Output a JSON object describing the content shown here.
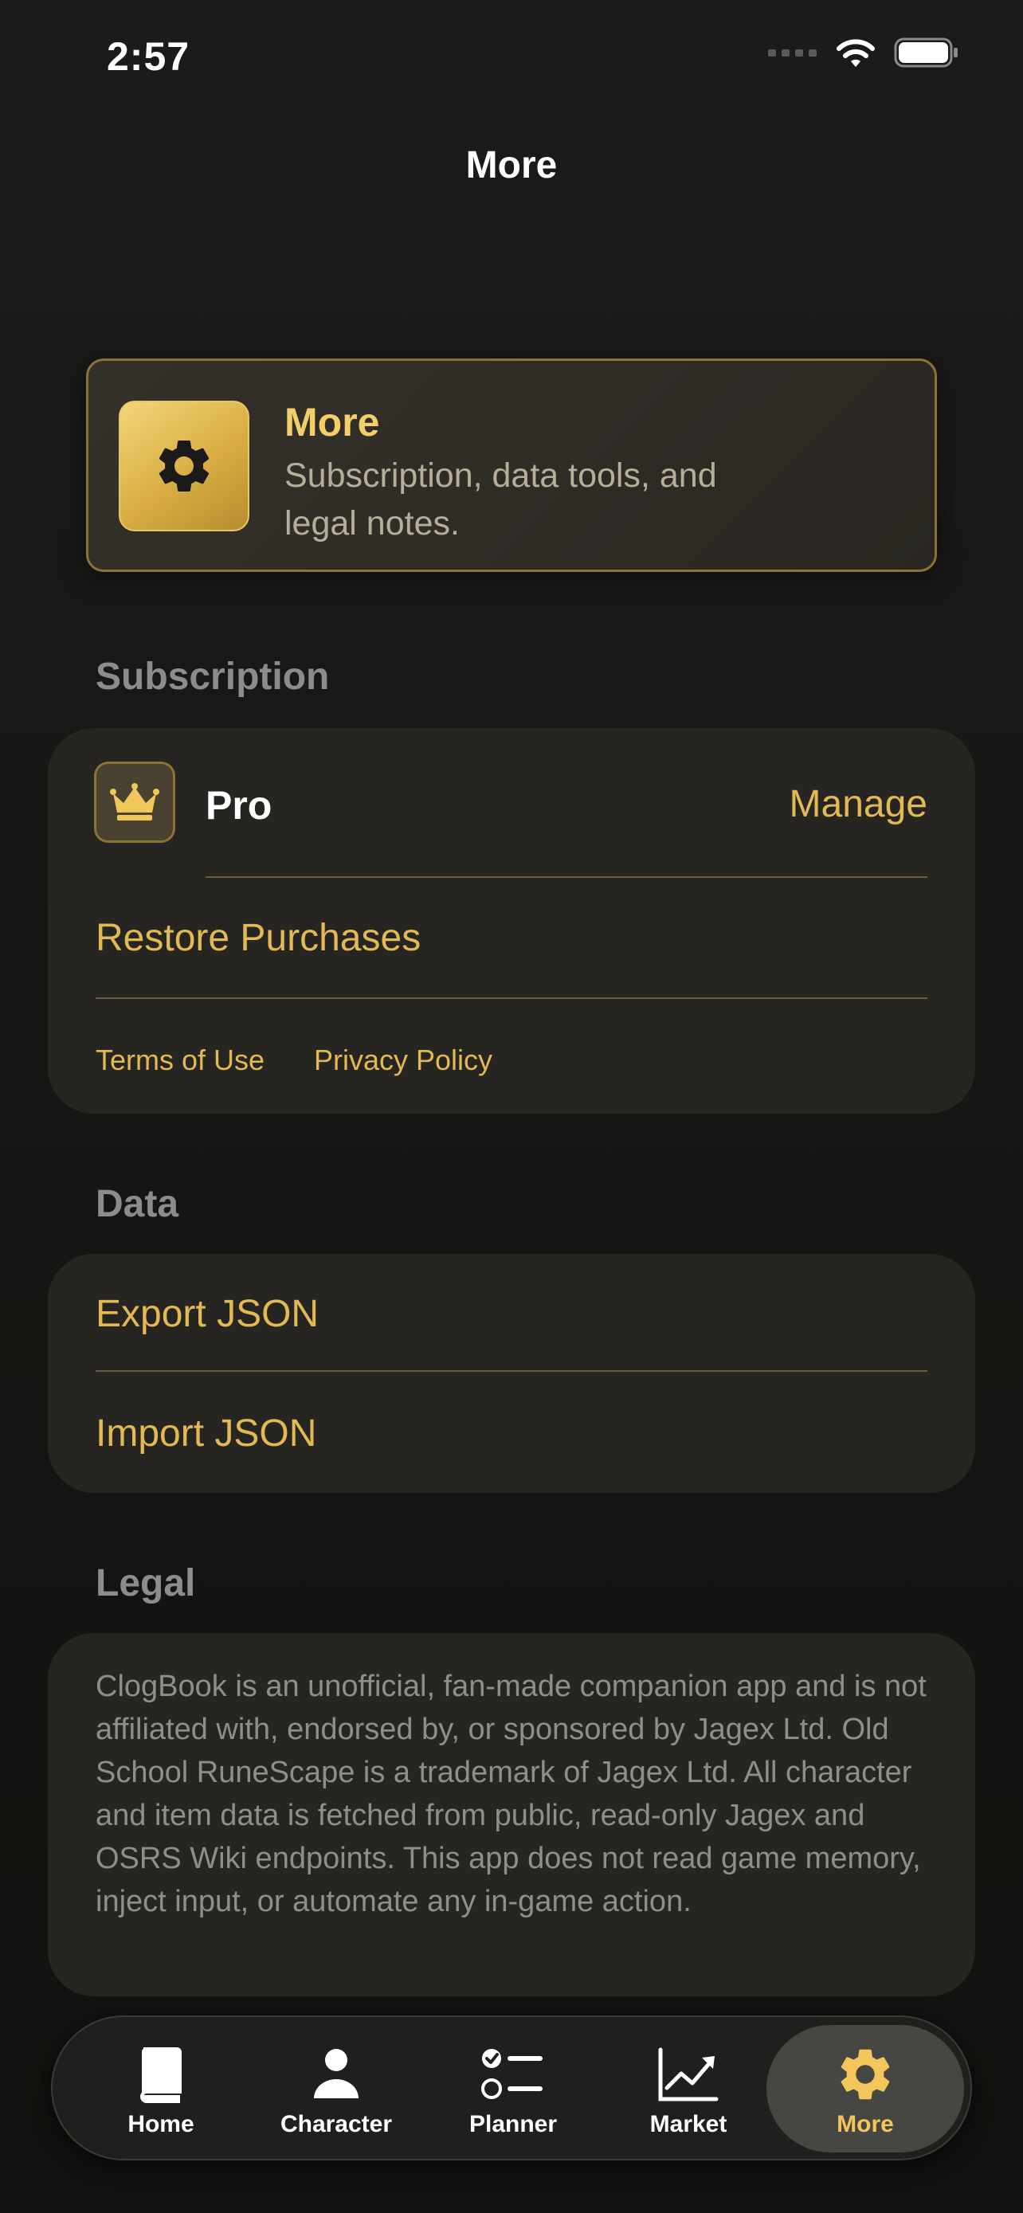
{
  "status_bar": {
    "time": "2:57"
  },
  "nav": {
    "title": "More"
  },
  "hero": {
    "title": "More",
    "subtitle": "Subscription, data tools, and legal notes.",
    "icon": "gear-icon"
  },
  "subscription": {
    "header": "Subscription",
    "plan_label": "Pro",
    "plan_icon": "crown-icon",
    "manage_label": "Manage",
    "restore_label": "Restore Purchases",
    "terms_label": "Terms of Use",
    "privacy_label": "Privacy Policy"
  },
  "data_section": {
    "header": "Data",
    "export_label": "Export JSON",
    "import_label": "Import JSON"
  },
  "legal": {
    "header": "Legal",
    "text": "ClogBook is an unofficial, fan-made companion app and is not affiliated with, endorsed by, or sponsored by Jagex Ltd. Old School RuneScape is a trademark of Jagex Ltd. All character and item data is fetched from public, read-only Jagex and OSRS Wiki endpoints. This app does not read game memory, inject input, or automate any in-game action."
  },
  "tabs": {
    "items": [
      {
        "label": "Home",
        "icon": "book-icon"
      },
      {
        "label": "Character",
        "icon": "person-icon"
      },
      {
        "label": "Planner",
        "icon": "checklist-icon"
      },
      {
        "label": "Market",
        "icon": "chart-line-icon"
      },
      {
        "label": "More",
        "icon": "gear-icon"
      }
    ],
    "active": "More"
  },
  "colors": {
    "accent_gold": "#e2b952",
    "background": "#151613",
    "card": "#272521"
  }
}
